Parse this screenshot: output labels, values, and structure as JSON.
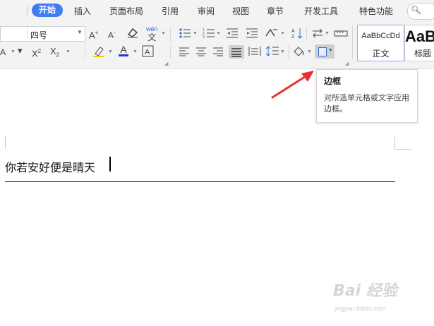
{
  "menu": {
    "tabs": [
      "开始",
      "插入",
      "页面布局",
      "引用",
      "审阅",
      "视图",
      "章节",
      "开发工具",
      "特色功能"
    ],
    "search_label": "查"
  },
  "ribbon": {
    "font_size": "四号",
    "style_normal_sample": "AaBbCcDd",
    "style_normal_label": "正文",
    "style_heading_sample": "AaB",
    "style_heading_label": "标题",
    "phonetic_label": "wén"
  },
  "tooltip": {
    "title": "边框",
    "description": "对所选单元格或文字应用边框。"
  },
  "document": {
    "text": "你若安好便是晴天"
  },
  "watermark": {
    "text": "Bai 经验",
    "sub": "jingyan.baidu.com"
  },
  "colors": {
    "active_tab": "#3f7cf5",
    "annotation_arrow": "#e8322f",
    "border_icon": "#2b6fd6"
  },
  "icons": {
    "arrow": "annotation-arrow-icon",
    "border": "border-icon"
  }
}
